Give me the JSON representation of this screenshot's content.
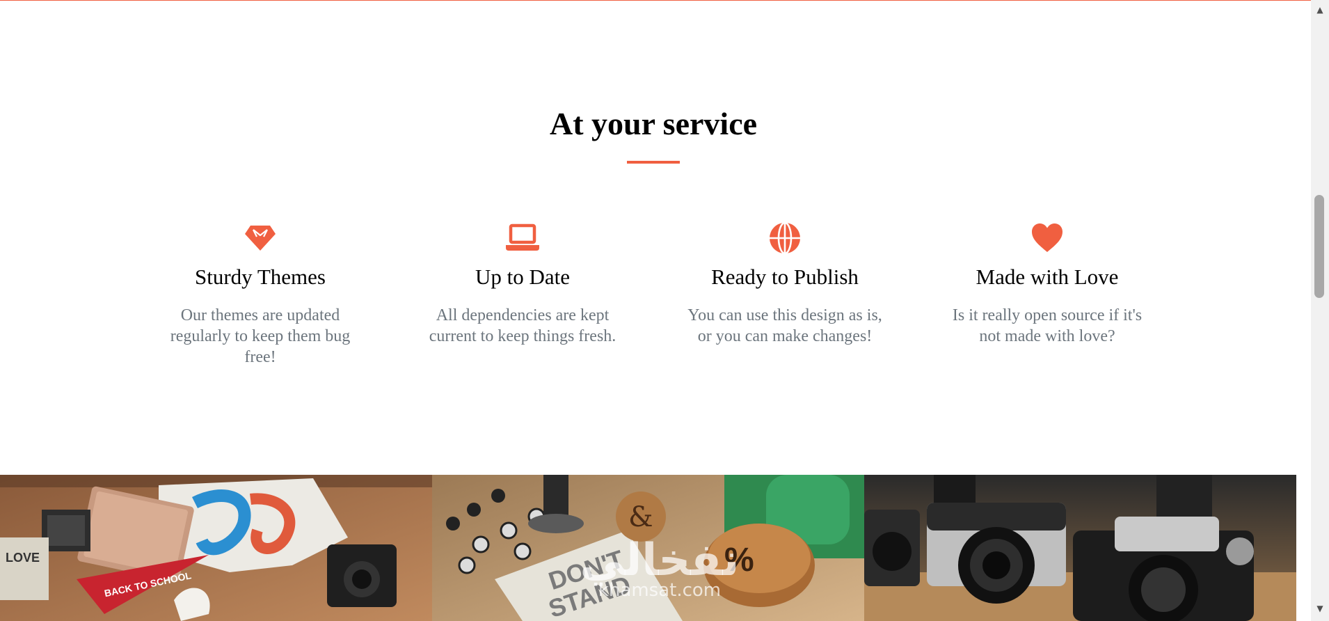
{
  "services_section": {
    "title": "At your service",
    "accent_color": "#f05f40",
    "items": [
      {
        "icon": "gem-icon",
        "title": "Sturdy Themes",
        "text": "Our themes are updated regularly to keep them bug free!"
      },
      {
        "icon": "laptop-icon",
        "title": "Up to Date",
        "text": "All dependencies are kept current to keep things fresh."
      },
      {
        "icon": "globe-icon",
        "title": "Ready to Publish",
        "text": "You can use this design as is, or you can make changes!"
      },
      {
        "icon": "heart-icon",
        "title": "Made with Love",
        "text": "Is it really open source if it's not made with love?"
      }
    ]
  },
  "portfolio": {
    "tiles": [
      {
        "icon": "thumbnail-image-1"
      },
      {
        "icon": "thumbnail-image-2"
      },
      {
        "icon": "thumbnail-image-3"
      }
    ]
  },
  "watermark": {
    "arabic": "نفخالي",
    "latin": "khamsat.com"
  },
  "scrollbar": {
    "up_arrow": "▲",
    "down_arrow": "▼"
  }
}
